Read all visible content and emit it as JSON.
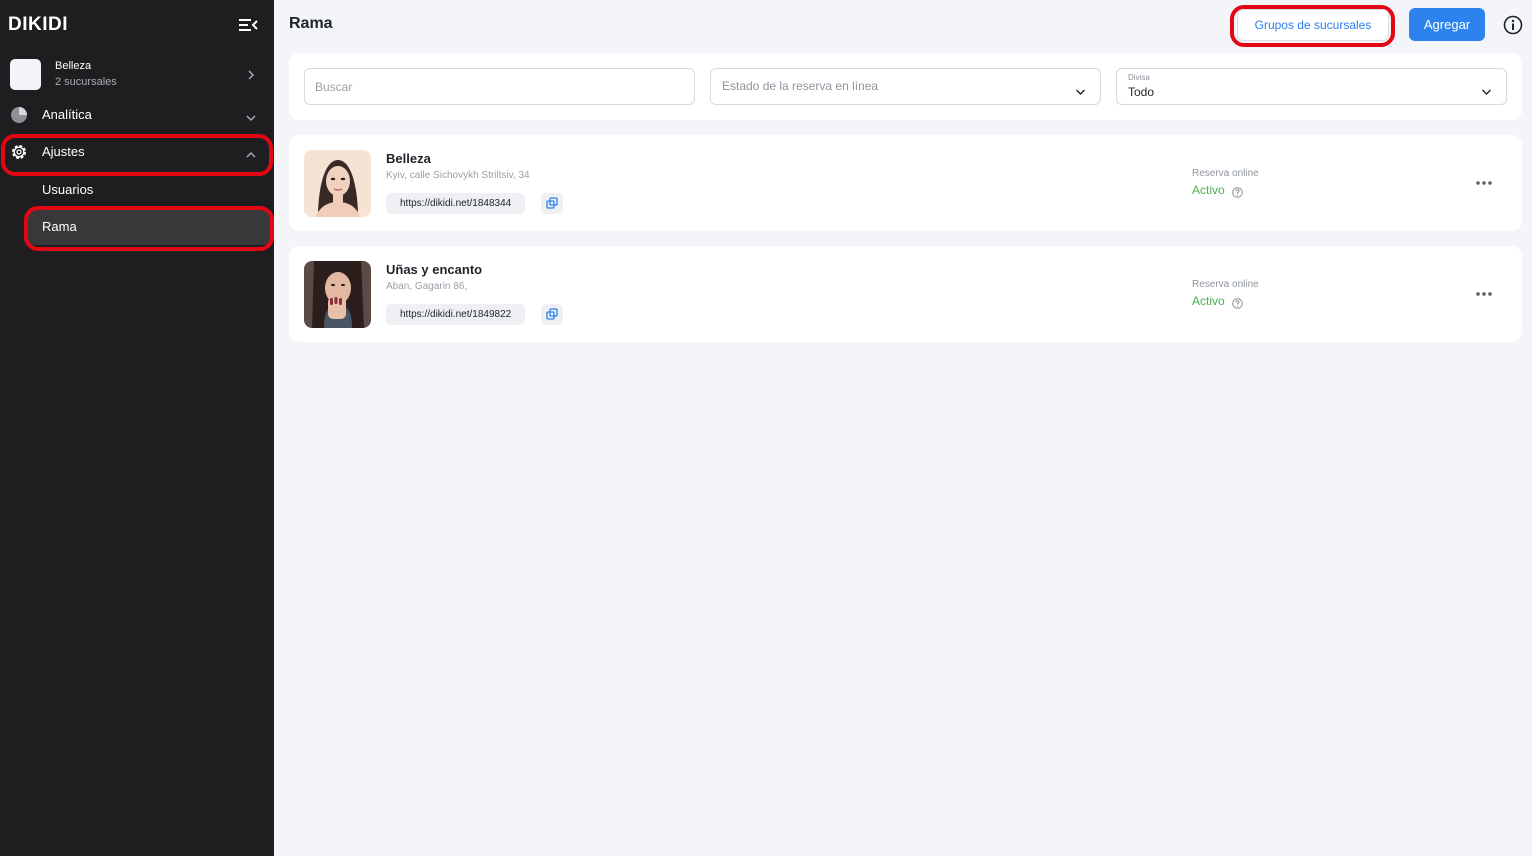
{
  "app": {
    "logo": "DIKIDI"
  },
  "company": {
    "name": "Belleza",
    "branches": "2 sucursales"
  },
  "sidebar": {
    "items": [
      {
        "label": "Analítica"
      },
      {
        "label": "Ajustes"
      }
    ],
    "subitems": [
      {
        "label": "Usuarios"
      },
      {
        "label": "Rama"
      }
    ]
  },
  "header": {
    "title": "Rama",
    "groups_button": "Grupos de sucursales",
    "add_button": "Agregar"
  },
  "filters": {
    "search_placeholder": "Buscar",
    "status_placeholder": "Estado de la reserva en línea",
    "currency_label": "Divisa",
    "currency_value": "Todo"
  },
  "branches": [
    {
      "name": "Belleza",
      "address": "Kyiv, calle Sichovykh Striltsiv, 34",
      "link": "https://dikidi.net/1848344",
      "reservation_label": "Reserva online",
      "reservation_status": "Activo"
    },
    {
      "name": "Uñas y encanto",
      "address": "Aban, Gagarin 86,",
      "link": "https://dikidi.net/1849822",
      "reservation_label": "Reserva online",
      "reservation_status": "Activo"
    }
  ],
  "colors": {
    "sidebar_bg": "#1e1e20",
    "accent": "#2d83ee",
    "active_status": "#4caf50",
    "highlight": "#e30613"
  },
  "icons": [
    "menu-collapse-icon",
    "chevron-right-icon",
    "pie-chart-icon",
    "gear-icon",
    "chevron-down-icon",
    "chevron-up-icon",
    "info-icon",
    "copy-icon",
    "help-icon",
    "more-icon"
  ]
}
